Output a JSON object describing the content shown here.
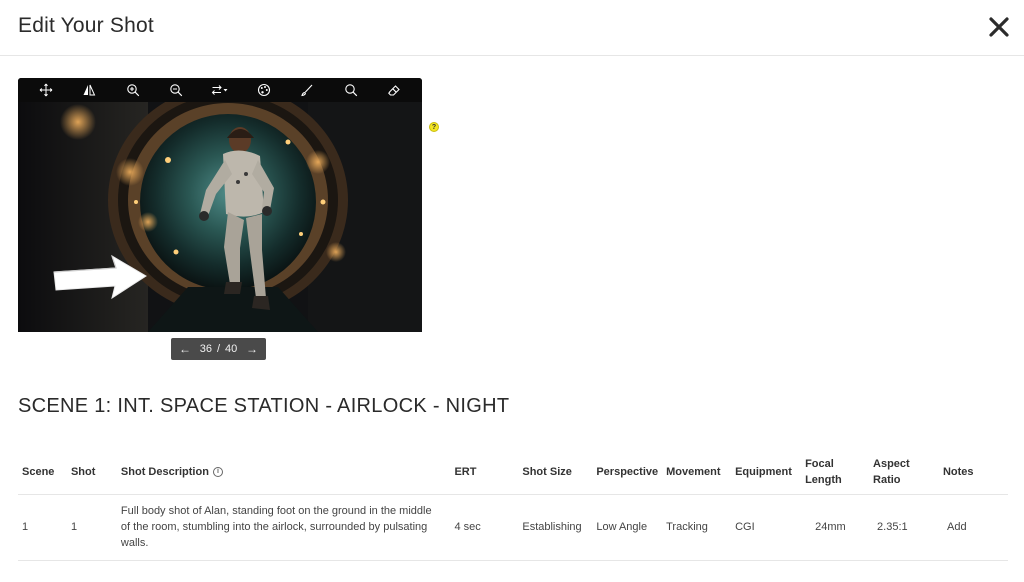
{
  "header": {
    "title": "Edit Your Shot",
    "close_icon": "close-icon"
  },
  "toolbar": {
    "tools": [
      "move-icon",
      "flip-icon",
      "zoom-in-icon",
      "zoom-out-icon",
      "swap-icon",
      "palette-icon",
      "brush-icon",
      "search-icon",
      "eraser-icon"
    ]
  },
  "image": {
    "description_icon": "astronaut-airlock-image"
  },
  "help": {
    "label": "?"
  },
  "pager": {
    "prev_icon": "arrow-left-icon",
    "next_icon": "arrow-right-icon",
    "current": "36",
    "separator": "/",
    "total": "40"
  },
  "scene": {
    "title": "SCENE 1:  INT. SPACE STATION - AIRLOCK - NIGHT"
  },
  "table": {
    "headers": [
      "Scene",
      "Shot",
      "Shot Description",
      "ERT",
      "Shot Size",
      "Perspective",
      "Movement",
      "Equipment",
      "Focal Length",
      "Aspect Ratio",
      "Notes"
    ],
    "info_glyph": "i",
    "rows": [
      {
        "scene": "1",
        "shot": "1",
        "description": "Full body shot of Alan, standing foot on the ground in the middle of the room, stumbling into the airlock, surrounded by pulsating walls.",
        "ert": "4 sec",
        "shot_size": "Establishing",
        "perspective": "Low Angle",
        "movement": "Tracking",
        "equipment": "CGI",
        "focal_length": "24mm",
        "aspect_ratio": "2.35:1",
        "notes": "Add"
      }
    ]
  },
  "colors": {
    "toolbar_bg": "#0b0b0b",
    "pager_bg": "#4a4a4a",
    "help_dot": "#f3e521",
    "border": "#e6e6e6"
  }
}
